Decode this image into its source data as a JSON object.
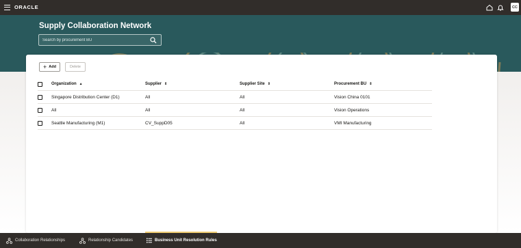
{
  "header": {
    "brand": "ORACLE",
    "avatar_initials": "CC",
    "icons": [
      "hamburger-icon",
      "home-icon",
      "bell-icon"
    ]
  },
  "hero": {
    "title": "Supply Collaboration Network",
    "search_placeholder": "Search by procurement BU"
  },
  "toolbar": {
    "add_label": "Add",
    "delete_label": "Delete"
  },
  "table": {
    "columns": [
      "Organization",
      "Supplier",
      "Supplier Site",
      "Procurement BU"
    ],
    "sort_indicators": [
      "▲",
      "⇕",
      "⇕",
      "⇕"
    ],
    "rows": [
      {
        "organization": "Singapore Distribution Center (D1)",
        "supplier": "All",
        "supplier_site": "All",
        "procurement_bu": "Vision China 0101"
      },
      {
        "organization": "All",
        "supplier": "All",
        "supplier_site": "All",
        "procurement_bu": "Vision Operations"
      },
      {
        "organization": "Seattle Manufacturing (M1)",
        "supplier": "CV_SuppD05",
        "supplier_site": "All",
        "procurement_bu": "VMI Manufacturing"
      }
    ]
  },
  "bottom_nav": {
    "tabs": [
      {
        "label": "Collaboration Relationships",
        "icon": "network-icon"
      },
      {
        "label": "Relationship Candidates",
        "icon": "network-search-icon"
      },
      {
        "label": "Business Unit Resolution Rules",
        "icon": "list-rules-icon",
        "active": true
      }
    ]
  },
  "colors": {
    "top_bar": "#312d2a",
    "hero": "#29595c",
    "active_tab_indicator": "#f0cc71"
  }
}
